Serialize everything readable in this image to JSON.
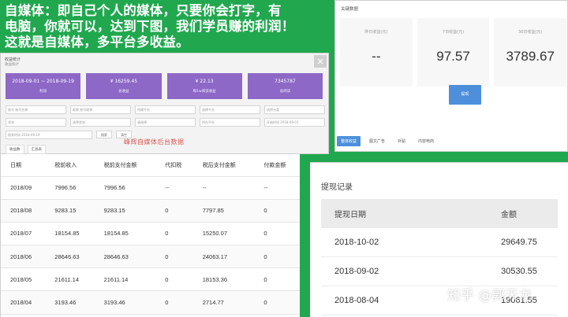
{
  "headline": {
    "line1": "自媒体：即自己个人的媒体，只要你会打字，有",
    "line2": "电脑，你就可以，达到下图，我们学员赚的利润！",
    "line3": "这就是自媒体，多平台多收益。"
  },
  "earnings": {
    "title": "收益统计",
    "subtitle": "收益统计",
    "close": "×",
    "cards": [
      {
        "value": "2018-09-01 ~ 2018-09-19",
        "label": "利润"
      },
      {
        "value": "¥ 16259.45",
        "label": "总收益"
      },
      {
        "value": "¥ 22.13",
        "label": "每1w阅读收益"
      },
      {
        "value": "7345787",
        "label": "总阅读"
      }
    ],
    "filters_row1": [
      "账号  账号名称",
      "昵称  账号昵称",
      "所属平台",
      "选择平台",
      "选择分类"
    ],
    "filters_row2": [
      "状态",
      "选择状态",
      "请选择",
      "所在平台",
      "开始时间  2018-09-01"
    ],
    "filters_row3": [
      "结束时间  2018-09-19"
    ],
    "search_label": "搜索",
    "reset_label": "清空",
    "watermark": "峰辉自媒体后台数据",
    "tabs": [
      "收益数",
      "汇总表"
    ]
  },
  "yesterday": {
    "title": "关键数据",
    "stats": [
      {
        "label": "昨日收益(元)",
        "value": "--"
      },
      {
        "label": "7日收益(元)",
        "value": "97.57"
      },
      {
        "label": "30日收益(元)",
        "value": "3789.67"
      }
    ],
    "button_label": "提现",
    "tabs": [
      "整体收益",
      "图文广告",
      "补贴",
      "内容电商"
    ],
    "accent": "#4d8fdb"
  },
  "tax_table": {
    "headers": [
      "日期",
      "税前收入",
      "税前支付金额",
      "代扣税",
      "税后支付金额",
      "付款金额"
    ],
    "rows": [
      [
        "2018/09",
        "7996.56",
        "7996.56",
        "--",
        "--",
        "--"
      ],
      [
        "2018/08",
        "9283.15",
        "9283.15",
        "0",
        "7797.85",
        "0"
      ],
      [
        "2018/07",
        "18154.85",
        "18154.85",
        "0",
        "15250.07",
        "0"
      ],
      [
        "2018/06",
        "28646.63",
        "28646.63",
        "0",
        "24063.17",
        "0"
      ],
      [
        "2018/05",
        "21611.14",
        "21611.14",
        "0",
        "18153.36",
        "0"
      ],
      [
        "2018/04",
        "3193.46",
        "3193.46",
        "0",
        "2714.77",
        "0"
      ]
    ]
  },
  "withdrawal": {
    "title": "提现记录",
    "headers": [
      "提现日期",
      "金额"
    ],
    "rows": [
      [
        "2018-10-02",
        "29649.75"
      ],
      [
        "2018-09-02",
        "30530.55"
      ],
      [
        "2018-08-04",
        "19061.55"
      ]
    ]
  },
  "watermark_zhihu": "知乎 @郭天龙",
  "colors": {
    "background": "#21a84f",
    "card": "#8e68c7"
  }
}
